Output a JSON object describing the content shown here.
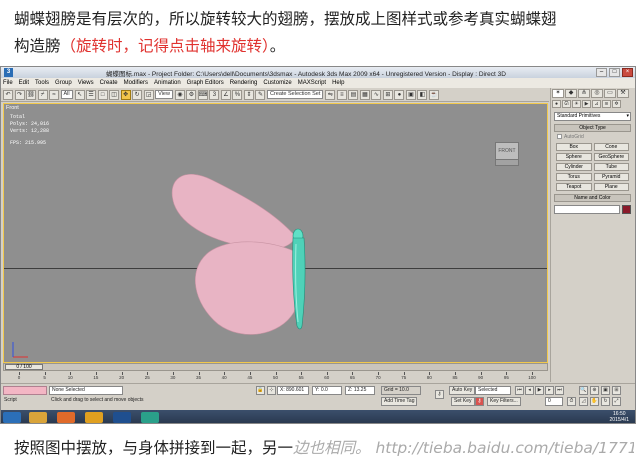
{
  "caption_top": {
    "line1": "蝴蝶翅膀是有层次的，所以旋转较大的翅膀，摆放成上图样式或参考真实蝴蝶翅",
    "line2_plain": "构造膀",
    "line2_red": "（旋转时，记得点击轴来旋转）",
    "line2_tail": "。"
  },
  "caption_bottom": {
    "text": "按照图中摆放，与身体拼接到一起，另一",
    "watermark": "边也相同。 http://tieba.baidu.com/tieba/1771"
  },
  "app": {
    "title": "蝴蝶图标.max    - Project Folder: C:\\Users\\dell\\Documents\\3dsmax    - Autodesk 3ds Max  2009 x64  -  Unregistered Version    - Display : Direct 3D",
    "app_icon": "3",
    "window_buttons": [
      "–",
      "□",
      "×"
    ],
    "menu": [
      "File",
      "Edit",
      "Tools",
      "Group",
      "Views",
      "Create",
      "Modifiers",
      "Animation",
      "Graph Editors",
      "Rendering",
      "Customize",
      "MAXScript",
      "Help"
    ],
    "toolbar": {
      "filter_select": "All",
      "coord_select": "View",
      "selection_set": "Create Selection Set"
    },
    "viewport": {
      "label": "Front",
      "stats": {
        "total": "Total",
        "polys": "Polys: 24,016",
        "verts": "Verts: 12,288",
        "fps": "FPS:  215.995"
      },
      "viewcube_label": "FRONT"
    },
    "time_slider": {
      "label": "0 / 100"
    },
    "ruler_labels": [
      "0",
      "5",
      "10",
      "15",
      "20",
      "25",
      "30",
      "35",
      "40",
      "45",
      "50",
      "55",
      "60",
      "65",
      "70",
      "75",
      "80",
      "85",
      "90",
      "95",
      "100"
    ],
    "status": {
      "selection": "None Selected",
      "prompt": "Click and drag to select and move objects",
      "x": "X: 890.601",
      "y": "Y: 0.0",
      "z": "Z: 13.25",
      "grid": "Grid = 10.0",
      "add_time_tag": "Add Time Tag",
      "auto_key": "Auto Key",
      "key_select": "Selected",
      "set_key": "Set Key",
      "key_filters": "Key Filters...",
      "frame": "0",
      "script_label": "Script"
    },
    "taskbar": {
      "time": "16:50",
      "date": "2015/4/1"
    },
    "command_panel": {
      "category": "Standard Primitives",
      "object_type_title": "Object Type",
      "autogrid": "AutoGrid",
      "primitives": [
        "Box",
        "Cone",
        "Sphere",
        "GeoSphere",
        "Cylinder",
        "Tube",
        "Torus",
        "Pyramid",
        "Teapot",
        "Plane"
      ],
      "name_color_title": "Name and Color"
    }
  },
  "colors": {
    "wing": "#e8b4c4",
    "body": "#4fd1b8",
    "viewport_bg": "#8f8f8f",
    "red_caption": "#e0322f",
    "swatch": "#8b1a2a"
  }
}
